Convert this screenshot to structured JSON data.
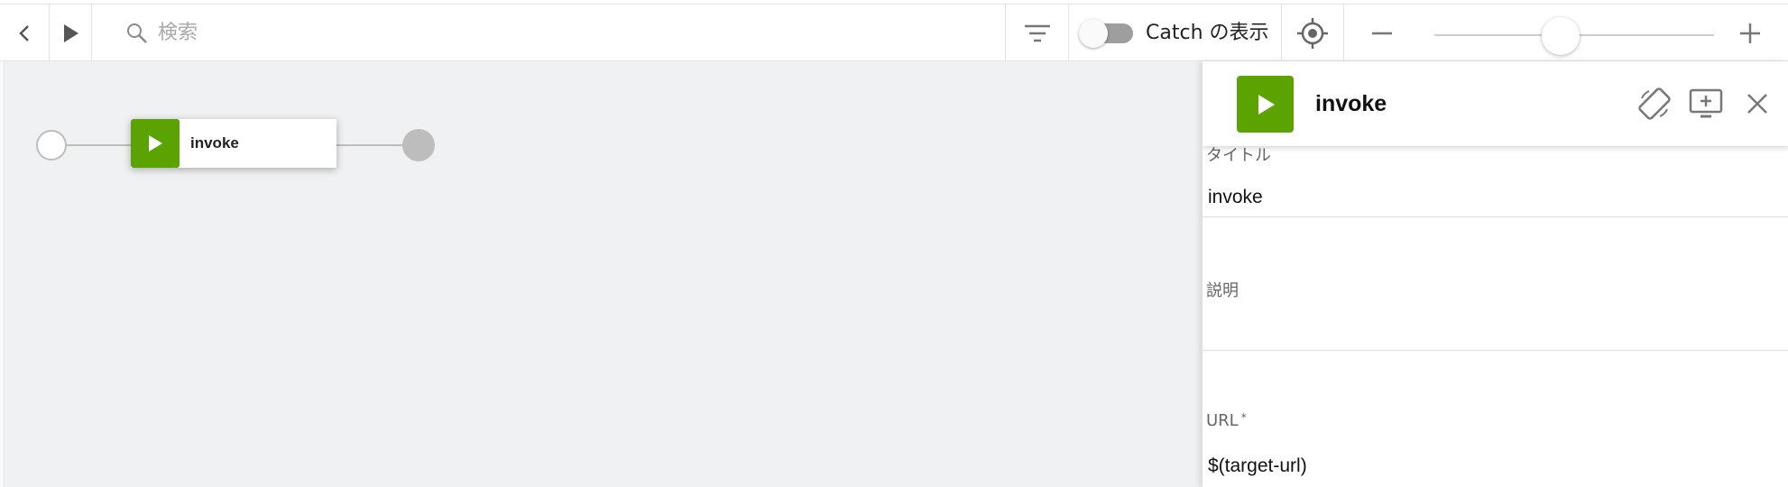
{
  "toolbar": {
    "back_icon": "chevron-left-icon",
    "run_icon": "play-icon",
    "search": {
      "placeholder": "検索",
      "value": ""
    },
    "filter_icon": "filter-icon",
    "catch_toggle": {
      "label": "Catch の表示",
      "on": false
    },
    "locate_icon": "target-icon",
    "zoom": {
      "out_icon": "minus-icon",
      "in_icon": "plus-icon",
      "level_fraction": 0.45
    }
  },
  "canvas": {
    "task": {
      "label": "invoke",
      "icon": "play-icon",
      "color": "#5ba300"
    },
    "start_node": "start-circle",
    "end_node": "end-circle"
  },
  "panel": {
    "title": "invoke",
    "icon": "play-icon",
    "rotate_icon": "screen-rotation-icon",
    "add_screen_icon": "add-to-screen-icon",
    "close_icon": "close-icon",
    "fields": {
      "title": {
        "label": "タイトル",
        "value": "invoke"
      },
      "description": {
        "label": "説明",
        "value": ""
      },
      "url": {
        "label": "URL",
        "required_mark": "*",
        "value": "$(target-url)"
      }
    }
  },
  "colors": {
    "accent": "#5ba300",
    "canvas_bg": "#f0f1f3",
    "line": "#bdbdbd"
  }
}
